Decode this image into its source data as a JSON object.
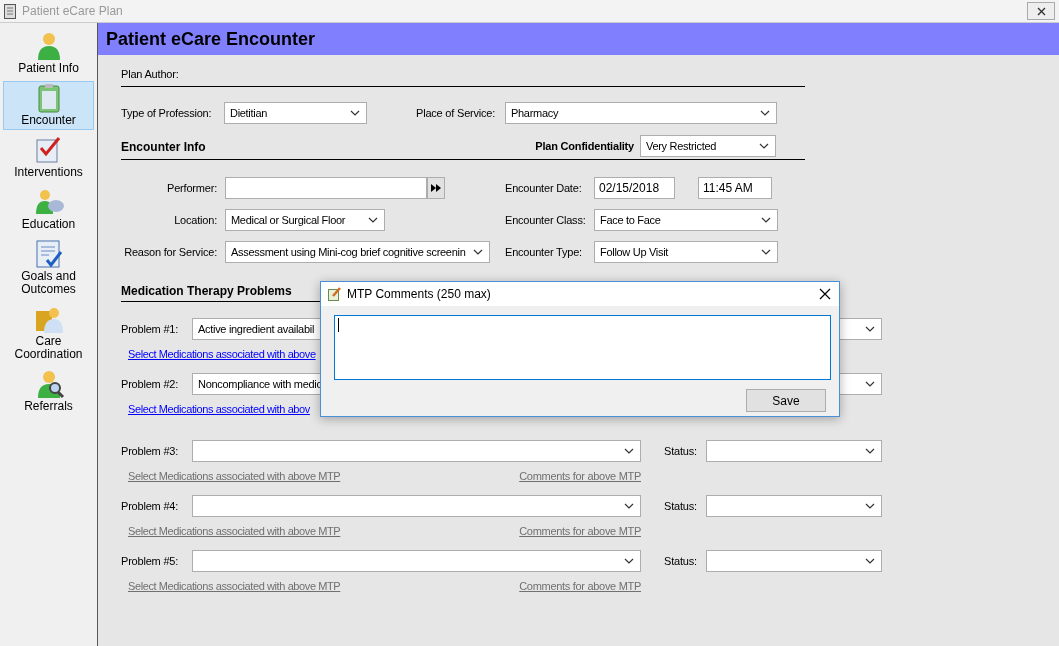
{
  "window": {
    "title": "Patient eCare Plan"
  },
  "sidebar": {
    "items": [
      {
        "label": "Patient Info",
        "selected": false
      },
      {
        "label": "Encounter",
        "selected": true
      },
      {
        "label": "Interventions",
        "selected": false
      },
      {
        "label": "Education",
        "selected": false
      },
      {
        "label": "Goals and Outcomes",
        "selected": false
      },
      {
        "label": "Care Coordination",
        "selected": false
      },
      {
        "label": "Referrals",
        "selected": false
      }
    ]
  },
  "header": {
    "title": "Patient eCare Encounter"
  },
  "plan_author": {
    "label": "Plan Author:"
  },
  "profession": {
    "label": "Type of Profession:",
    "value": "Dietitian"
  },
  "place_of_service": {
    "label": "Place of Service:",
    "value": "Pharmacy"
  },
  "encounter_info": {
    "heading": "Encounter Info"
  },
  "confidentiality": {
    "label": "Plan Confidentiality",
    "value": "Very Restricted"
  },
  "performer": {
    "label": "Performer:"
  },
  "encounter_date": {
    "label": "Encounter Date:",
    "date": "02/15/2018",
    "time": "11:45 AM"
  },
  "location": {
    "label": "Location:",
    "value": "Medical or Surgical Floor"
  },
  "encounter_class": {
    "label": "Encounter Class:",
    "value": "Face to Face"
  },
  "reason": {
    "label": "Reason for Service:",
    "value": "Assessment using Mini-cog brief cognitive screenin"
  },
  "encounter_type": {
    "label": "Encounter Type:",
    "value": "Follow Up Visit"
  },
  "mtp": {
    "heading": "Medication Therapy Problems",
    "problems": [
      {
        "label": "Problem #1:",
        "value": "Active ingredient availabil",
        "enabled": true,
        "select_link": "Select Medications associated with above"
      },
      {
        "label": "Problem #2:",
        "value": "Noncompliance with medic",
        "enabled": true,
        "select_link": "Select Medications associated with abov"
      },
      {
        "label": "Problem #3:",
        "enabled": false,
        "select_link": "Select Medications associated with above MTP",
        "comments_link": "Comments for above MTP",
        "status_label": "Status:"
      },
      {
        "label": "Problem #4:",
        "enabled": false,
        "select_link": "Select Medications associated with above MTP",
        "comments_link": "Comments for above MTP",
        "status_label": "Status:"
      },
      {
        "label": "Problem #5:",
        "enabled": false,
        "select_link": "Select Medications associated with above MTP",
        "comments_link": "Comments for above MTP",
        "status_label": "Status:"
      }
    ]
  },
  "dialog": {
    "title": "MTP Comments (250 max)",
    "save": "Save"
  }
}
